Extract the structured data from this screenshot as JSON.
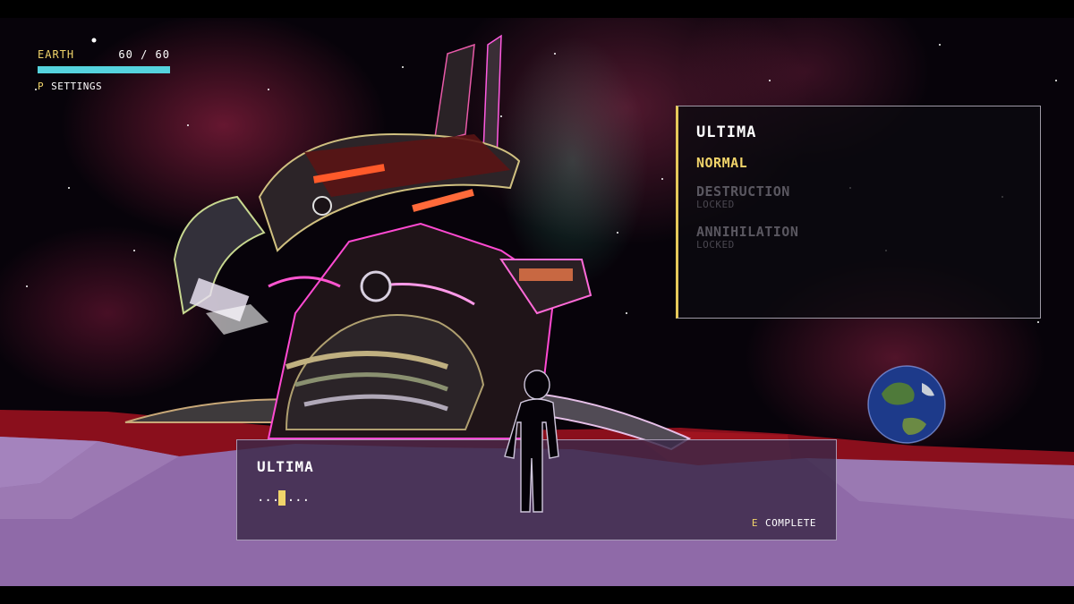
{
  "hud": {
    "planet_label": "EARTH",
    "hp_text": "60 / 60",
    "hp_fraction": 1.0,
    "hp_color": "#55d3de",
    "settings_key": "P",
    "settings_label": "SETTINGS"
  },
  "difficulty_panel": {
    "title": "ULTIMA",
    "options": [
      {
        "label": "NORMAL",
        "sub": "",
        "state": "selected"
      },
      {
        "label": "DESTRUCTION",
        "sub": "LOCKED",
        "state": "locked"
      },
      {
        "label": "ANNIHILATION",
        "sub": "LOCKED",
        "state": "locked"
      }
    ]
  },
  "dialogue": {
    "speaker": "ULTIMA",
    "text": ".......",
    "complete_key": "E",
    "complete_label": "COMPLETE"
  },
  "colors": {
    "accent_yellow": "#f1d46a",
    "locked_gray": "#5a5760",
    "ground_purple": "#8f6aa8",
    "horizon_red": "#8a0f1c"
  },
  "icons": [
    "player-silhouette-icon",
    "planet-earth-icon",
    "mech-boss-icon",
    "text-cursor-icon"
  ]
}
